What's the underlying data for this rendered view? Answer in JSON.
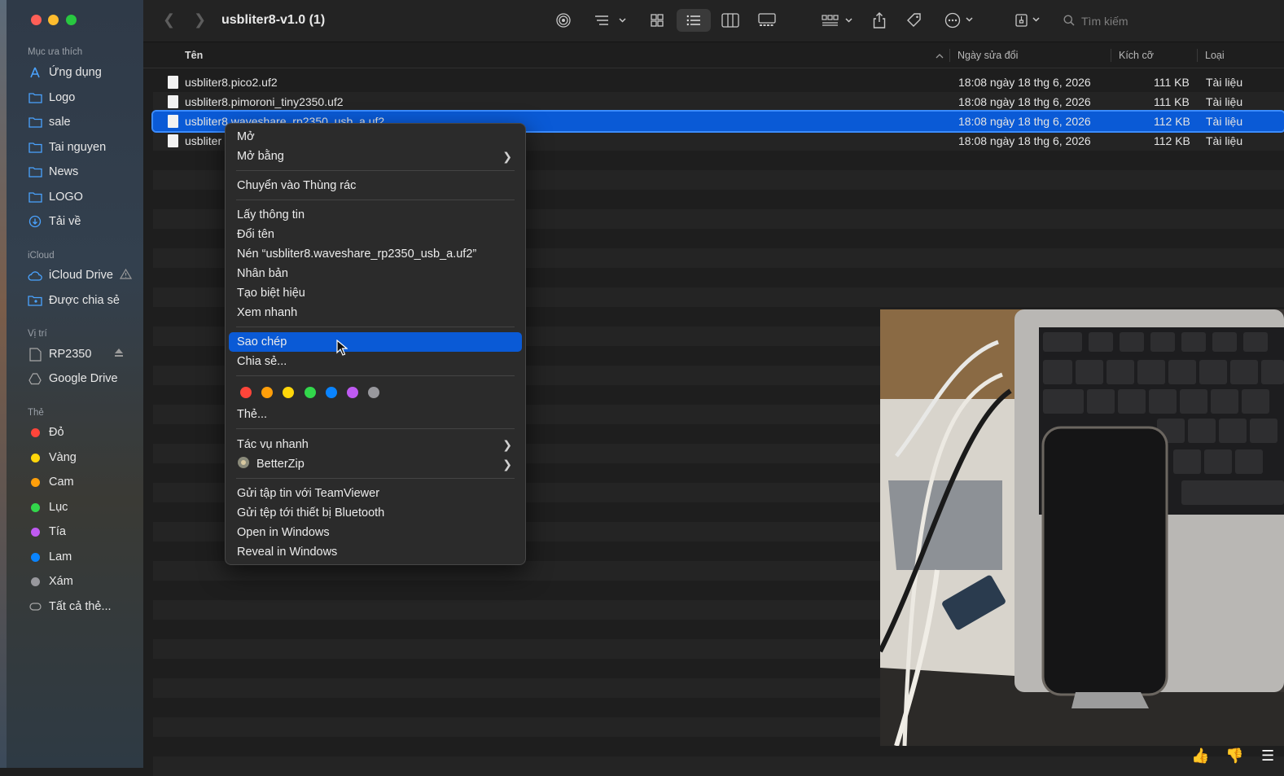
{
  "window": {
    "title": "usbliter8-v1.0 (1)"
  },
  "sidebar": {
    "favorites_title": "Mục ưa thích",
    "favorites": [
      {
        "label": "Ứng dụng",
        "icon": "apps-icon"
      },
      {
        "label": "Logo",
        "icon": "folder-icon"
      },
      {
        "label": "sale",
        "icon": "folder-icon"
      },
      {
        "label": "Tai nguyen",
        "icon": "folder-icon"
      },
      {
        "label": "News",
        "icon": "folder-icon"
      },
      {
        "label": "LOGO",
        "icon": "folder-icon"
      },
      {
        "label": "Tải về",
        "icon": "download-icon"
      }
    ],
    "icloud_title": "iCloud",
    "icloud": [
      {
        "label": "iCloud Drive",
        "icon": "cloud-icon"
      },
      {
        "label": "Được chia sẻ",
        "icon": "shared-folder-icon"
      }
    ],
    "locations_title": "Vị trí",
    "locations": [
      {
        "label": "RP2350",
        "icon": "drive-icon"
      },
      {
        "label": "Google Drive",
        "icon": "google-drive-icon"
      }
    ],
    "tags_title": "Thẻ",
    "tags": [
      {
        "label": "Đỏ",
        "color": "#ff453a"
      },
      {
        "label": "Vàng",
        "color": "#ffd60a"
      },
      {
        "label": "Cam",
        "color": "#ff9f0a"
      },
      {
        "label": "Lục",
        "color": "#32d74b"
      },
      {
        "label": "Tía",
        "color": "#bf5af2"
      },
      {
        "label": "Lam",
        "color": "#0a84ff"
      },
      {
        "label": "Xám",
        "color": "#98989d"
      },
      {
        "label": "Tất cả thẻ...",
        "color": ""
      }
    ]
  },
  "toolbar": {
    "search_placeholder": "Tìm kiếm"
  },
  "columns": {
    "name": "Tên",
    "date": "Ngày sửa đổi",
    "size": "Kích cỡ",
    "kind": "Loại"
  },
  "files": [
    {
      "name": "usbliter8.pico2.uf2",
      "date": "18:08 ngày 18 thg 6, 2026",
      "size": "111 KB",
      "kind": "Tài liệu"
    },
    {
      "name": "usbliter8.pimoroni_tiny2350.uf2",
      "date": "18:08 ngày 18 thg 6, 2026",
      "size": "111 KB",
      "kind": "Tài liệu"
    },
    {
      "name": "usbliter8.waveshare_rp2350_usb_a.uf2",
      "date": "18:08 ngày 18 thg 6, 2026",
      "size": "112 KB",
      "kind": "Tài liệu",
      "selected": true
    },
    {
      "name": "usbliter",
      "date": "18:08 ngày 18 thg 6, 2026",
      "size": "112 KB",
      "kind": "Tài liệu"
    }
  ],
  "context_menu": {
    "open": "Mở",
    "open_with": "Mở bằng",
    "trash": "Chuyển vào Thùng rác",
    "get_info": "Lấy thông tin",
    "rename": "Đổi tên",
    "compress": "Nén “usbliter8.waveshare_rp2350_usb_a.uf2”",
    "duplicate": "Nhân bản",
    "alias": "Tạo biệt hiệu",
    "quick_look": "Xem nhanh",
    "copy": "Sao chép",
    "share": "Chia sẻ...",
    "tag_colors": [
      "#ff453a",
      "#ff9f0a",
      "#ffd60a",
      "#32d74b",
      "#0a84ff",
      "#bf5af2",
      "#98989d"
    ],
    "tags": "Thẻ...",
    "quick_actions": "Tác vụ nhanh",
    "betterzip": "BetterZip",
    "teamviewer": "Gửi tập tin với TeamViewer",
    "bluetooth": "Gửi tệp tới thiết bị Bluetooth",
    "open_windows": "Open in Windows",
    "reveal_windows": "Reveal in Windows"
  }
}
